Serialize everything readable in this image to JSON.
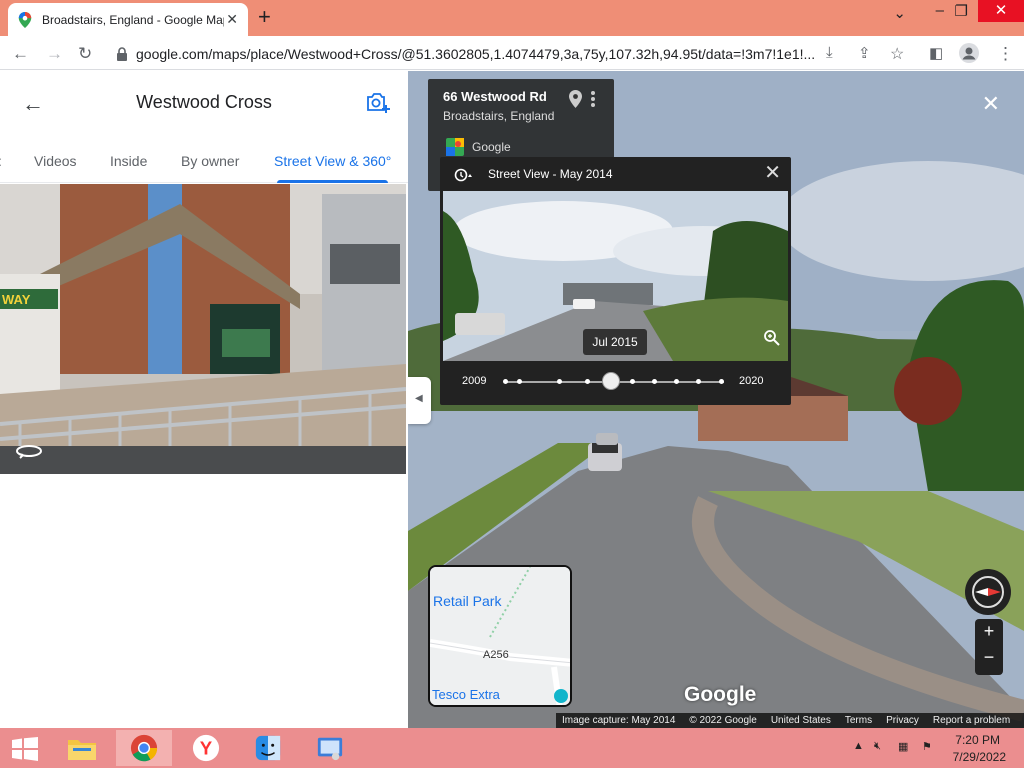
{
  "browser": {
    "tab_title": "Broadstairs, England - Google Maps",
    "url": "google.com/maps/place/Westwood+Cross/@51.3602805,1.4074479,3a,75y,107.32h,94.95t/data=!3m7!1e1!..."
  },
  "left_panel": {
    "title": "Westwood Cross",
    "tabs": [
      {
        "label": "Videos"
      },
      {
        "label": "Inside"
      },
      {
        "label": "By owner"
      },
      {
        "label": "Street View & 360°"
      }
    ],
    "active_tab": "Street View & 360°"
  },
  "street_view": {
    "address_line1": "66 Westwood Rd",
    "address_line2": "Broadstairs, England",
    "source": "Google",
    "time_machine": {
      "label": "Street View - May 2014",
      "selected_date": "Jul 2015",
      "year_start": "2009",
      "year_end": "2020"
    },
    "minimap": {
      "label_top": "Retail Park",
      "road": "A256",
      "label_bottom": "Tesco Extra"
    },
    "logo": "Google",
    "footer": {
      "capture": "Image capture: May 2014",
      "copyright": "© 2022 Google",
      "country": "United States",
      "terms": "Terms",
      "privacy": "Privacy",
      "report": "Report a problem"
    }
  },
  "taskbar": {
    "time": "7:20 PM",
    "date": "7/29/2022"
  },
  "colors": {
    "tabbar": "#ef8e76",
    "taskbar": "#eb8e8f",
    "accent": "#1a73e8"
  }
}
